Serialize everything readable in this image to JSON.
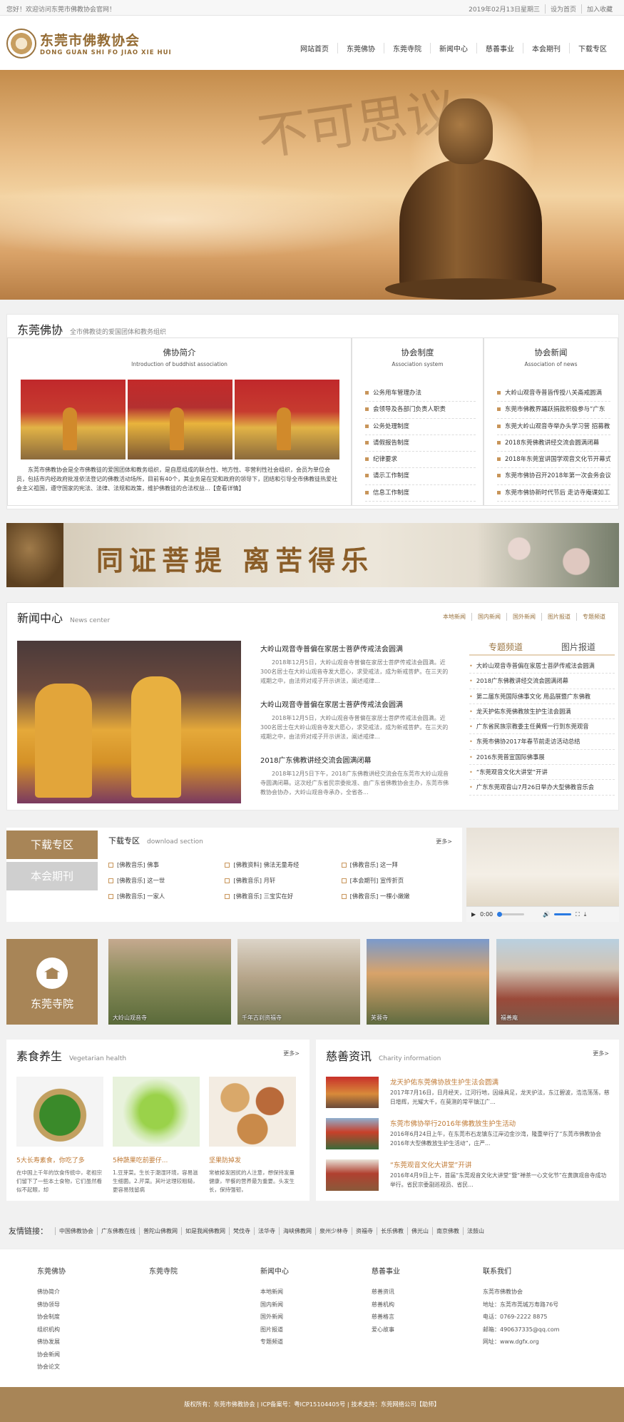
{
  "topbar": {
    "welcome": "您好！欢迎访问东莞市佛教协会官网！",
    "date": "2019年02月13日星期三",
    "set_home": "设为首页",
    "favorite": "加入收藏"
  },
  "header": {
    "logo_cn": "东莞市佛教协会",
    "logo_en": "DONG GUAN SHI FO JIAO XIE HUI",
    "nav": [
      "网站首页",
      "东莞佛协",
      "东莞寺院",
      "新闻中心",
      "慈善事业",
      "本会期刊",
      "下载专区"
    ]
  },
  "hero": {
    "callig": "不可思议"
  },
  "dongguan": {
    "title": "东莞佛协",
    "subtitle": "全市佛教徒的爱国团体和教务组织",
    "intro_title": "佛协简介",
    "intro_sub": "Introduction of buddhist association",
    "intro_text": "东莞市佛教协会是全市佛教徒的爱国团体和教务组织，是自愿组成的联合性、地方性、非营利性社会组织，会员为单位会员，包括市内经政府批准依法登记的佛教活动场所，目前有40个，其业务是在党和政府的领导下，团结和引导全市佛教徒热爱社会主义祖国，遵守国家的宪法、法律、法规和政策，维护佛教徒的合法权益...【查看详情】",
    "system_title": "协会制度",
    "system_sub": "Association system",
    "system_items": [
      "公务用车管理办法",
      "会领导及各部门负责人职责",
      "公务处理制度",
      "请假报告制度",
      "纪律要求",
      "请示工作制度",
      "信息工作制度"
    ],
    "news_title": "协会新闻",
    "news_sub": "Association of news",
    "news_items": [
      "大岭山观音寺普皆传授八关斋戒圆满",
      "东莞市佛教界踊跃捐款积极参与“广东",
      "东莞大岭山观音寺举办头学习营 招募教法",
      "2018东莞佛教讲经交流会圆满闭幕",
      "2018年东莞宣讲国学观音文化节开幕式",
      "东莞市佛协召开2018年第一次会务会议",
      "东莞市佛协新时代节后 走访寺庵课如工"
    ]
  },
  "banner2": {
    "text": "同证菩提 离苦得乐"
  },
  "news": {
    "title": "新闻中心",
    "subtitle": "News center",
    "tabs": [
      "本地新闻",
      "国内新闻",
      "国外新闻",
      "图片报道",
      "专题频道"
    ],
    "items": [
      {
        "title": "大岭山观音寺普偏在家居士菩萨传戒法会圆满",
        "desc": "2018年12月5日，大岭山观音寺普偏在家居士菩萨传戒法会圆满。近300名居士在大岭山观音寺发大愿心，求受戒法，成为新戒菩萨。在三天的戒期之中，由法师对戒子开示讲法，阐述戒律..."
      },
      {
        "title": "大岭山观音寺普偏在家居士菩萨传戒法会圆满",
        "desc": "2018年12月5日，大岭山观音寺普偏在家居士菩萨传戒法会圆满。近300名居士在大岭山观音寺发大愿心，求受戒法，成为新戒菩萨。在三天的戒期之中，由法师对戒子开示讲法，阐述戒律..."
      },
      {
        "title": "2018广东佛教讲经交流会圆满闭幕",
        "desc": "2018年12月5日下午，2018广东佛教讲经交流会在东莞市大岭山观音寺圆满闭幕。这次经广东省民宗委批准、由广东省佛教协会主办，东莞市佛教协会协办，大岭山观音寺承办，全省各..."
      }
    ],
    "side_tabs": [
      "专题频道",
      "图片报道"
    ],
    "side_items": [
      "大岭山观音寺普偏在家居士菩萨传戒法会圆满",
      "2018广东佛教讲经交流会圆满闭幕",
      "第二届东莞国际佛事文化 用品展暨广东佛教",
      "龙天护佑东莞佛教放生护生法会圆满",
      "广东省民族宗教委主任黄辉一行到东莞观音",
      "东莞市佛协2017年春节前走访活动总结",
      "2016东莞普宣国际佛事展",
      "“东莞观音文化大讲堂”开讲",
      "广东东莞观音山7月26日举办大型佛教音乐会"
    ]
  },
  "download": {
    "tab_download": "下载专区",
    "tab_journal": "本会期刊",
    "title": "下载专区",
    "subtitle": "download section",
    "more": "更多>",
    "items": [
      "[佛教音乐] 佛事",
      "[佛教资料] 佛法无量寿经",
      "[佛教音乐] 这一拜",
      "[佛教音乐] 这一世",
      "[佛教音乐] 月轩",
      "[本会期刊] 宣传折页",
      "[佛教音乐] 一家人",
      "[佛教音乐] 三宝实在好",
      "[佛教音乐] 一棵小嫩嫩"
    ]
  },
  "video": {
    "time": "0:00"
  },
  "temples": {
    "title": "东莞寺院",
    "items": [
      "大岭山观音寺",
      "千年古刹资福寺",
      "芙蓉寺",
      "福善庵"
    ]
  },
  "veg": {
    "title": "素食养生",
    "subtitle": "Vegetarian health",
    "more": "更多>",
    "items": [
      {
        "title": "5大长寿素食，你吃了多",
        "desc": "在中国上千年的饮食传统中，老祖宗们留下了一些本土食物，它们虽然看似不起眼，却"
      },
      {
        "title": "5种蔬果吃前要仔...",
        "desc": "1.豆芽菜。生长于潮湿环境，容易滋生细菌。2.芹菜。其叶这理较粗糙，更容易残留病"
      },
      {
        "title": "坚果防掉发",
        "desc": "常被掉发困扰的人注意，想保持发量健康，早餐的营养最为重要。头发生长，保持强韧，"
      }
    ]
  },
  "charity": {
    "title": "慈善资讯",
    "subtitle": "Charity information",
    "more": "更多>",
    "items": [
      {
        "title": "龙天护佑东莞佛协放生护生法会圆满",
        "desc": "2017年7月16日，日月经天，江河行地，因缘具足，龙天护法，东江碧波，浩浩荡荡，慈日增辉，光耀大千，在莫测的常平镇江广..."
      },
      {
        "title": "东莞市佛协举行2016年佛教放生护生活动",
        "desc": "2016年6月24日上午，在东莞市石龙镇东江岸边金沙湾，隆重举行了“东莞市佛教协会2016年大型佛教放生护生活动”，庄严..."
      },
      {
        "title": "“东莞观音文化大讲堂”开讲",
        "desc": "2016年4月9日上午，首届“东莞观音文化大讲堂”暨“禅茶一心文化节”在黄旗观音寺成功举行。省民宗委副巡视员、省民..."
      }
    ]
  },
  "links": {
    "label": "友情链接：",
    "items": [
      "中国佛教协会",
      "广东佛教在线",
      "普陀山佛教网",
      "如是我闻佛教网",
      "梵伐寺",
      "法华寺",
      "海峡佛教网",
      "泉州少林寺",
      "资福寺",
      "长乐佛教",
      "佛光山",
      "南京佛教",
      "法鼓山"
    ]
  },
  "footer": {
    "cols": [
      {
        "title": "东莞佛协",
        "items": [
          "佛协简介",
          "佛协领导",
          "协会制度",
          "组织机构",
          "佛协发展",
          "协会新闻",
          "协会论文"
        ]
      },
      {
        "title": "东莞寺院",
        "items": []
      },
      {
        "title": "新闻中心",
        "items": [
          "本地新闻",
          "国内新闻",
          "国外新闻",
          "图片报道",
          "专题频道"
        ]
      },
      {
        "title": "慈善事业",
        "items": [
          "慈善资讯",
          "慈善机构",
          "慈善格言",
          "爱心故事"
        ]
      },
      {
        "title": "联系我们",
        "items": [
          "东莞市佛教协会",
          "地址：东莞市莞城万寿路76号",
          "电话：0769-2222 8875",
          "邮箱：490637335@qq.com",
          "网址：www.dgfx.org"
        ]
      }
    ]
  },
  "copyright": "版权所有：东莞市佛教协会 | ICP备案号：粤ICP15104405号 | 技术支持：东莞网络公司【助师】"
}
